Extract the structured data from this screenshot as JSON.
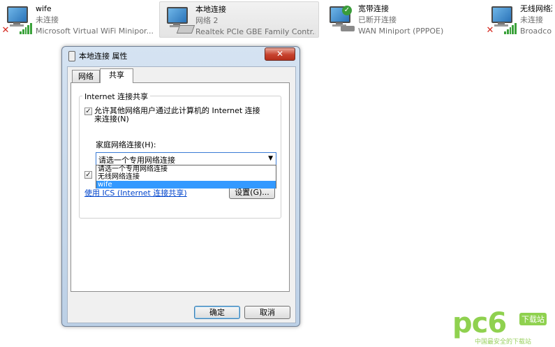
{
  "connections": [
    {
      "name": "wife",
      "status": "未连接",
      "adapter": "Microsoft Virtual WiFi Minipor..."
    },
    {
      "name": "本地连接",
      "status": "网络 2",
      "adapter": "Realtek PCIe GBE Family Contr..."
    },
    {
      "name": "宽带连接",
      "status": "已断开连接",
      "adapter": "WAN Miniport (PPPOE)"
    },
    {
      "name": "无线网络连",
      "status": "未连接",
      "adapter": "Broadcon"
    }
  ],
  "dialog": {
    "title": "本地连接 属性",
    "close_label": "✕",
    "tabs": [
      "网络",
      "共享"
    ],
    "group_title": "Internet 连接共享",
    "allow_share_label_line1": "允许其他网络用户通过此计算机的 Internet 连接",
    "allow_share_label_line2": "来连接(N)",
    "allow_share_checked": true,
    "home_network_label": "家庭网络连接(H):",
    "combo_value": "请选一个专用网络连接",
    "dropdown_options": [
      "请选一个专用网络连接",
      "无线网络连接",
      "wife"
    ],
    "dropdown_highlight_index": 2,
    "second_checkbox_checked": true,
    "ics_link": "使用 ICS (Internet 连接共享)",
    "settings_button": "设置(G)...",
    "ok_button": "确定",
    "cancel_button": "取消"
  },
  "watermark": {
    "brand": "pc6",
    "tag": "下载站",
    "sub": "中国最安全的下载站"
  },
  "colors": {
    "selection": "#3399ff",
    "link": "#0044cc",
    "close_button": "#c7422e",
    "watermark": "#8fd14f"
  }
}
